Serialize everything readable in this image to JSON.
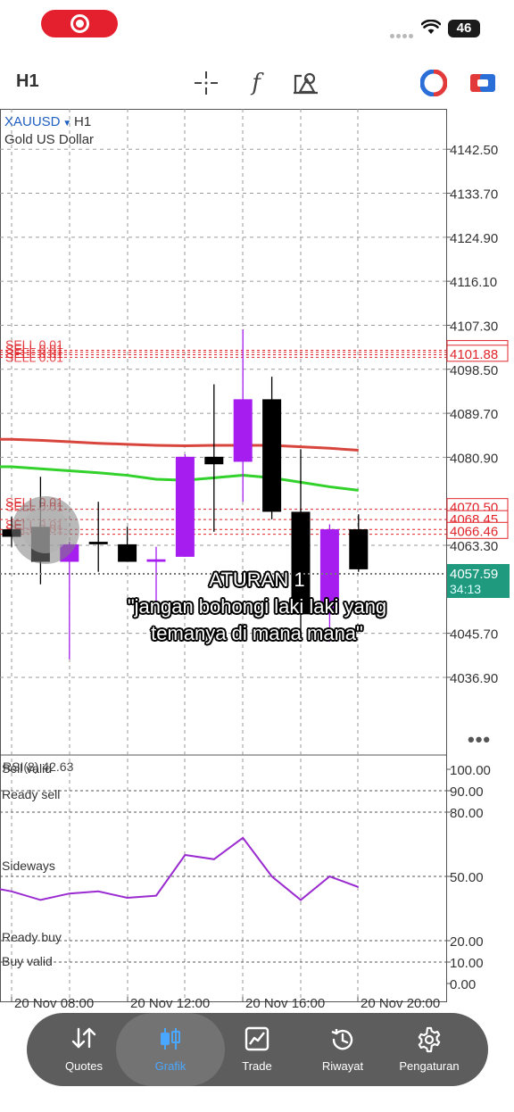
{
  "status_bar": {
    "battery": "46",
    "icons": [
      "screen-record-icon",
      "signal-dots-icon",
      "wifi-icon",
      "battery-icon"
    ]
  },
  "toolbar": {
    "timeframe": "H1",
    "icons": [
      "crosshair-icon",
      "function-icon",
      "objects-icon",
      "trading-signal-icon",
      "one-click-trading-icon"
    ],
    "function_glyph": "f"
  },
  "chart": {
    "symbol": "XAUUSD",
    "timeframe": "H1",
    "description": "Gold US Dollar",
    "sell_label": "SELL 0.01",
    "current_price": "4057.59",
    "countdown": "34:13",
    "sell_price_upper": "4101.88",
    "sell_price_upper_hidden": "4102.00",
    "sell_price_lower_a": "4070.50",
    "sell_price_lower_b": "4068.45",
    "sell_price_lower_c": "4066.46",
    "more_glyph": "•••"
  },
  "chart_data": {
    "type": "candlestick",
    "symbol": "XAUUSD",
    "timeframe": "H1",
    "y_ticks": [
      "4142.50",
      "4133.70",
      "4124.90",
      "4116.10",
      "4107.30",
      "4098.50",
      "4089.70",
      "4080.90",
      "4063.30",
      "4045.70",
      "4036.90"
    ],
    "ylim": [
      4031,
      4147
    ],
    "x_ticks": [
      "20 Nov 08:00",
      "20 Nov 12:00",
      "20 Nov 16:00",
      "20 Nov 20:00"
    ],
    "candles": [
      {
        "open": 4066.5,
        "high": 4069.0,
        "low": 4063.0,
        "close": 4065.0
      },
      {
        "open": 4067.0,
        "high": 4077.0,
        "low": 4055.5,
        "close": 4060.0
      },
      {
        "open": 4060.0,
        "high": 4064.0,
        "low": 4040.5,
        "close": 4063.5
      },
      {
        "open": 4064.0,
        "high": 4072.0,
        "low": 4058.0,
        "close": 4063.5
      },
      {
        "open": 4063.5,
        "high": 4067.0,
        "low": 4060.0,
        "close": 4060.0
      },
      {
        "open": 4060.0,
        "high": 4063.0,
        "low": 4051.0,
        "close": 4060.5
      },
      {
        "open": 4061.0,
        "high": 4081.5,
        "low": 4061.0,
        "close": 4081.0
      },
      {
        "open": 4081.0,
        "high": 4095.5,
        "low": 4066.0,
        "close": 4079.5
      },
      {
        "open": 4080.0,
        "high": 4106.5,
        "low": 4072.0,
        "close": 4092.5
      },
      {
        "open": 4092.5,
        "high": 4097.0,
        "low": 4068.5,
        "close": 4070.0
      },
      {
        "open": 4070.0,
        "high": 4082.5,
        "low": 4046.0,
        "close": 4049.5
      },
      {
        "open": 4049.5,
        "high": 4067.5,
        "low": 4044.0,
        "close": 4066.5
      },
      {
        "open": 4066.5,
        "high": 4069.5,
        "low": 4058.0,
        "close": 4058.5
      }
    ],
    "ma_red": [
      4084.5,
      4084.3,
      4084.0,
      4083.7,
      4083.5,
      4083.3,
      4083.2,
      4083.3,
      4083.3,
      4083.3,
      4083.0,
      4082.7,
      4082.3
    ],
    "ma_green": [
      4079.0,
      4078.6,
      4078.2,
      4077.8,
      4077.3,
      4076.5,
      4076.3,
      4076.8,
      4077.3,
      4076.8,
      4075.9,
      4075.0,
      4074.3
    ],
    "rsi": {
      "label": "RSI(8) 42.63",
      "values": [
        43,
        39,
        42,
        43,
        40,
        41,
        60,
        58,
        68,
        50,
        39,
        50,
        45
      ],
      "y_ticks": [
        "100.00",
        "90.00",
        "80.00",
        "50.00",
        "20.00",
        "10.00",
        "0.00"
      ],
      "ylim": [
        0,
        100
      ],
      "levels": [
        {
          "value": 90,
          "label": "Sell valid"
        },
        {
          "value": 80,
          "label": "Ready sell"
        },
        {
          "value": 50,
          "label": "Sideways"
        },
        {
          "value": 20,
          "label": "Ready buy"
        },
        {
          "value": 10,
          "label": "Buy valid"
        }
      ]
    }
  },
  "caption": {
    "line1": "ATURAN 1",
    "line2": "\"jangan bohongi laki laki yang",
    "line3": "temanya di mana mana\""
  },
  "colors": {
    "bull": "#a61df0",
    "bear": "#000000",
    "ma_red": "#d8453c",
    "ma_green": "#32d12c",
    "rsi_line": "#9a2bd0",
    "sell_line": "#e0242a",
    "current_price_bg": "#1f9a7f",
    "nav_active": "#4aa7ff"
  },
  "bottom_nav": {
    "items": [
      {
        "label": "Quotes",
        "icon": "quotes-arrows-icon",
        "active": false
      },
      {
        "label": "Grafik",
        "icon": "candles-icon",
        "active": true
      },
      {
        "label": "Trade",
        "icon": "trade-chart-icon",
        "active": false
      },
      {
        "label": "Riwayat",
        "icon": "history-icon",
        "active": false
      },
      {
        "label": "Pengaturan",
        "icon": "settings-gear-icon",
        "active": false
      }
    ]
  }
}
